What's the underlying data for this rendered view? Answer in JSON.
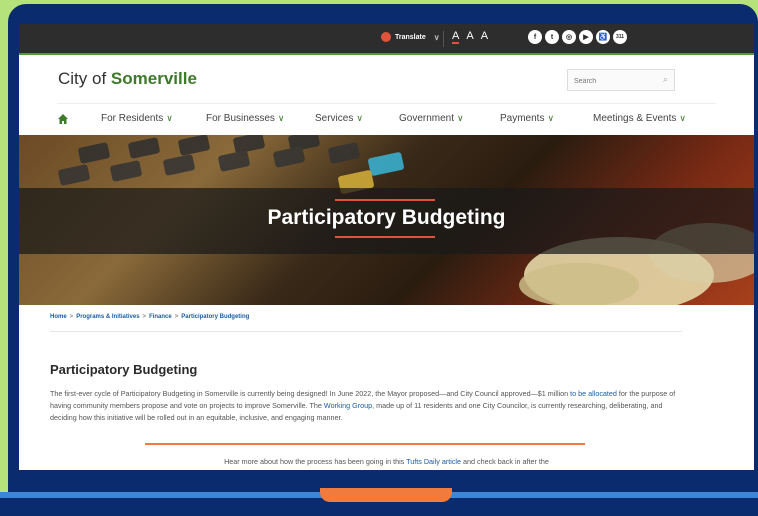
{
  "topbar": {
    "translate_label": "Translate",
    "text_sizes": [
      "A",
      "A",
      "A"
    ],
    "social": [
      {
        "icon": "facebook-icon",
        "glyph": "f"
      },
      {
        "icon": "twitter-icon",
        "glyph": "t"
      },
      {
        "icon": "instagram-icon",
        "glyph": "◎"
      },
      {
        "icon": "youtube-icon",
        "glyph": "▶"
      },
      {
        "icon": "accessibility-icon",
        "glyph": "♿"
      },
      {
        "icon": "311-icon",
        "glyph": "311"
      }
    ]
  },
  "header": {
    "logo_prefix": "City of ",
    "logo_name": "Somerville",
    "search_placeholder": "Search"
  },
  "nav": {
    "items": [
      "For Residents",
      "For Businesses",
      "Services",
      "Government",
      "Payments",
      "Meetings & Events"
    ]
  },
  "hero": {
    "title": "Participatory Budgeting"
  },
  "breadcrumb": [
    "Home",
    "Programs & Initiatives",
    "Finance",
    "Participatory Budgeting"
  ],
  "content": {
    "heading": "Participatory Budgeting",
    "intro_part1": "The first-ever cycle of Participatory Budgeting in Somerville is currently being designed! In June 2022, the Mayor proposed—and City Council approved—$1 million ",
    "intro_link1": "to be allocated",
    "intro_part2": " for the purpose of having community members propose and vote on projects to improve Somerville. The ",
    "intro_link2": "Working Group",
    "intro_part3": ", made up of 11 residents and one City Councilor, is currently researching, deliberating, and deciding how this initiative will be rolled out in an equitable, inclusive, and engaging manner.",
    "more_part1": "Hear more about how the process has been going in this ",
    "more_link": "Tufts Daily article",
    "more_part2": " and check back in after the"
  },
  "colors": {
    "brand_green": "#3d7a2a",
    "accent_orange": "#f07b3c",
    "link_blue": "#1a5da6",
    "frame_navy": "#0a2c6e",
    "backdrop_green": "#b5e27a"
  }
}
